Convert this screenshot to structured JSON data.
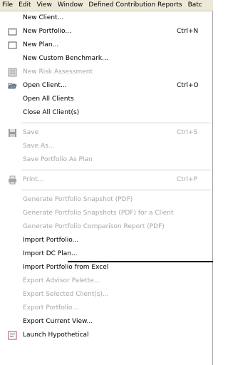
{
  "menubar": {
    "items": [
      "File",
      "Edit",
      "View",
      "Window",
      "Defined Contribution Reports",
      "Batc"
    ]
  },
  "file_menu": {
    "new_client": "New Client...",
    "new_portfolio": "New Portfolio...",
    "new_portfolio_sc": "Ctrl+N",
    "new_plan": "New Plan...",
    "new_custom_benchmark": "New Custom Benchmark...",
    "new_risk_assessment": "New Risk Assessment",
    "open_client": "Open Client...",
    "open_client_sc": "Ctrl+O",
    "open_all_clients": "Open All Clients",
    "close_all_clients": "Close All Client(s)",
    "save": "Save",
    "save_sc": "Ctrl+S",
    "save_as": "Save As...",
    "save_portfolio_as_plan": "Save Portfolio As Plan",
    "print": "Print...",
    "print_sc": "Ctrl+P",
    "gen_snapshot": "Generate Portfolio Snapshot (PDF)",
    "gen_snapshots_client": "Generate Portfolio Snapshots (PDF) for a Client",
    "gen_comparison": "Generate Portfolio Comparison Report (PDF)",
    "import_portfolio": "Import Portfolio...",
    "import_dc_plan": "Import DC Plan...",
    "import_portfolio_excel": "Import Portfolio from Excel",
    "export_advisor_palette": "Export Advisor Palette...",
    "export_selected_clients": "Export Selected Client(s)...",
    "export_portfolio": "Export Portfolio...",
    "export_current_view": "Export Current View...",
    "launch_hypothetical": "Launch Hypothetical"
  },
  "colors": {
    "menubar_bg": "#ece9d8",
    "disabled_text": "#a7a6aa"
  },
  "icons": [
    "portfolio-icon",
    "plan-icon",
    "risk-assessment-icon",
    "open-client-icon",
    "save-icon",
    "print-icon",
    "hypothetical-icon"
  ]
}
